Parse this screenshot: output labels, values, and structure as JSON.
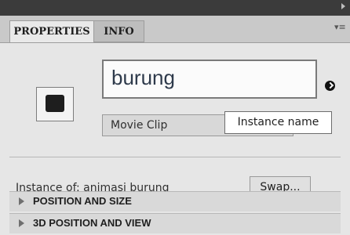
{
  "tabs": [
    "PROPERTIES",
    "INFO"
  ],
  "instance_name": {
    "value": "burung"
  },
  "symbol_type": {
    "selected": "Movie Clip"
  },
  "tooltip": "Instance name",
  "instance_of": {
    "label": "Instance of:",
    "value": "animasi burung"
  },
  "swap_button": "Swap...",
  "sections": [
    "POSITION AND SIZE",
    "3D POSITION AND VIEW"
  ],
  "icons": {
    "symbol": "movie-clip-symbol-icon",
    "link": "link-arrow-icon",
    "panel_menu": "panel-menu-icon"
  }
}
